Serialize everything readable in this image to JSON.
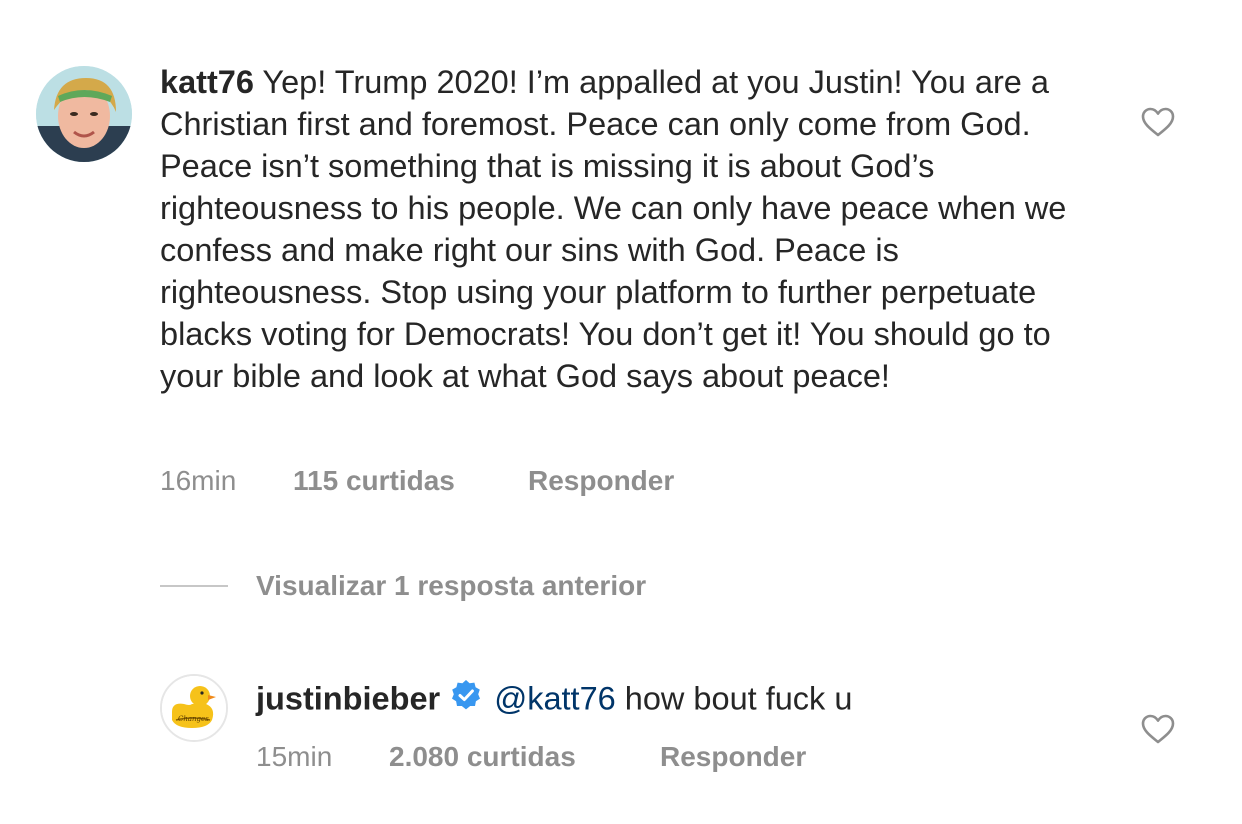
{
  "comments": [
    {
      "username": "katt76",
      "text": "Yep! Trump 2020! I’m appalled at you Justin! You are a Christian first and foremost. Peace can only come from God. Peace isn’t something that is missing it is about God’s righteousness to his people. We can only have peace when we confess and make right our sins with God. Peace is righteousness. Stop using your platform to further perpetuate blacks voting for Democrats! You don’t get it! You should go to your bible and look at what God says about peace!",
      "time": "16min",
      "likes": "115 curtidas",
      "reply_label": "Responder",
      "avatar_icon": "user-photo-avatar",
      "like_icon": "heart-outline-icon"
    }
  ],
  "view_replies": {
    "label": "Visualizar 1 resposta anterior"
  },
  "reply": {
    "username": "justinbieber",
    "verified_icon": "verified-badge-icon",
    "mention": "@katt76",
    "text": "how bout fuck u",
    "time": "15min",
    "likes": "2.080 curtidas",
    "reply_label": "Responder",
    "avatar_icon": "rubber-duck-changes-avatar",
    "like_icon": "heart-outline-icon"
  },
  "colors": {
    "text": "#262626",
    "secondary": "#8e8e8e",
    "mention": "#003569",
    "verified": "#3897f0",
    "divider": "#c7c7c7"
  }
}
